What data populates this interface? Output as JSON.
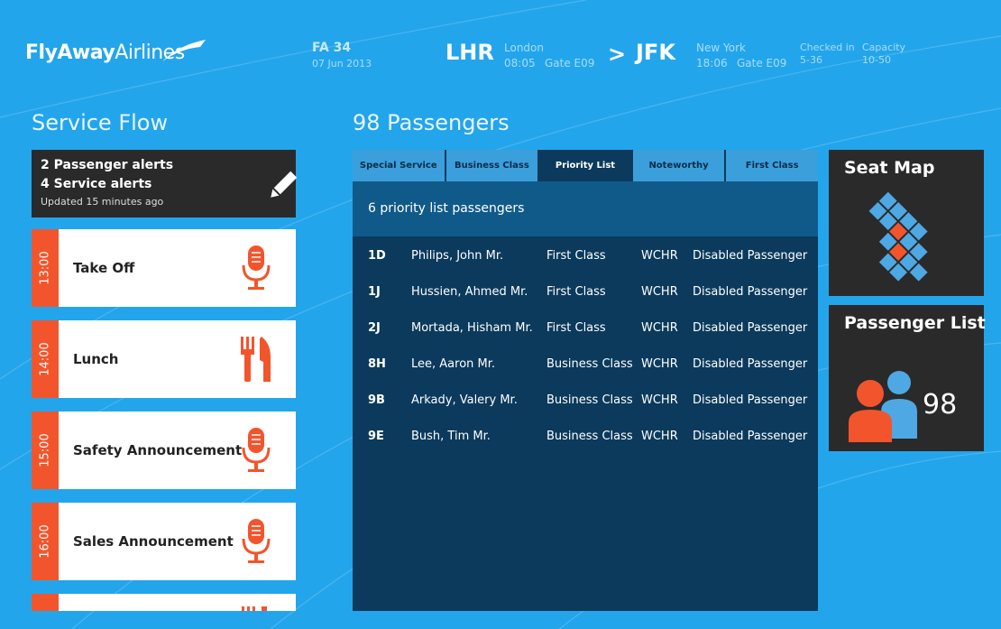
{
  "header": {
    "logo_part1": "FlyAway",
    "logo_part2": "Airlines",
    "flight_number": "FA 34",
    "flight_date": "07 Jun 2013",
    "origin": {
      "code": "LHR",
      "city": "London",
      "time": "08:05",
      "gate": "Gate E09"
    },
    "destination": {
      "code": "JFK",
      "city": "New York",
      "time": "18:06",
      "gate": "Gate E09"
    },
    "arrow": ">",
    "checked_in_label": "Checked in",
    "checked_in_value": "5-36",
    "capacity_label": "Capacity",
    "capacity_value": "10-50"
  },
  "service_flow": {
    "title": "Service Flow",
    "alerts": {
      "passenger_alerts": "2 Passenger alerts",
      "service_alerts": "4 Service alerts",
      "updated": "Updated 15 minutes ago",
      "icon": "pencil-icon"
    },
    "items": [
      {
        "time": "13:00",
        "label": "Take Off",
        "icon": "microphone-icon"
      },
      {
        "time": "14:00",
        "label": "Lunch",
        "icon": "cutlery-icon"
      },
      {
        "time": "15:00",
        "label": "Safety Announcement",
        "icon": "microphone-icon"
      },
      {
        "time": "16:00",
        "label": "Sales Announcement",
        "icon": "microphone-icon"
      }
    ]
  },
  "passengers": {
    "title": "98 Passengers",
    "tabs": [
      "Special Service",
      "Business Class",
      "Priority List",
      "Noteworthy",
      "First Class"
    ],
    "active_tab": "Priority List",
    "list_header": "6 priority list passengers",
    "rows": [
      {
        "seat": "1D",
        "name": "Philips, John Mr.",
        "class": "First Class",
        "code": "WCHR",
        "note": "Disabled Passenger"
      },
      {
        "seat": "1J",
        "name": "Hussien, Ahmed Mr.",
        "class": "First Class",
        "code": "WCHR",
        "note": "Disabled Passenger"
      },
      {
        "seat": "2J",
        "name": "Mortada, Hisham Mr.",
        "class": "First Class",
        "code": "WCHR",
        "note": "Disabled Passenger"
      },
      {
        "seat": "8H",
        "name": "Lee, Aaron Mr.",
        "class": "Business Class",
        "code": "WCHR",
        "note": "Disabled Passenger"
      },
      {
        "seat": "9B",
        "name": "Arkady, Valery Mr.",
        "class": "Business Class",
        "code": "WCHR",
        "note": "Disabled Passenger"
      },
      {
        "seat": "9E",
        "name": "Bush, Tim Mr.",
        "class": "Business Class",
        "code": "WCHR",
        "note": "Disabled Passenger"
      }
    ]
  },
  "tiles": {
    "seat_map": {
      "title": "Seat Map"
    },
    "passenger_list": {
      "title": "Passenger List",
      "count": "98"
    }
  },
  "colors": {
    "background": "#23a5ec",
    "accent_orange": "#f2552c",
    "panel_dark": "#0b3a5c",
    "tile_dark": "#2a2a2a"
  }
}
